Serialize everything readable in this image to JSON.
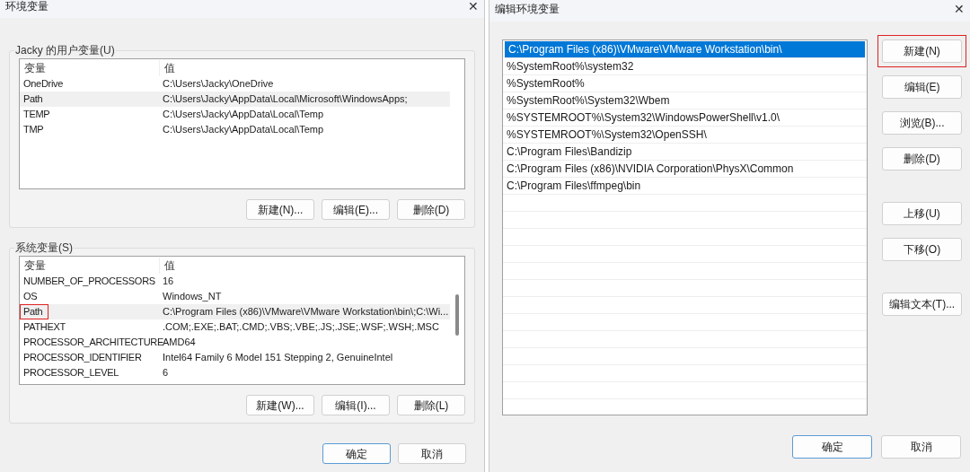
{
  "env_dialog": {
    "title": "环境变量",
    "close": "✕",
    "user_group": {
      "label": "Jacky 的用户变量(U)",
      "columns": [
        "变量",
        "值"
      ],
      "rows": [
        {
          "name": "OneDrive",
          "value": "C:\\Users\\Jacky\\OneDrive",
          "selected": false,
          "highlighted": false
        },
        {
          "name": "Path",
          "value": "C:\\Users\\Jacky\\AppData\\Local\\Microsoft\\WindowsApps;",
          "selected": true,
          "highlighted": false
        },
        {
          "name": "TEMP",
          "value": "C:\\Users\\Jacky\\AppData\\Local\\Temp",
          "selected": false,
          "highlighted": false
        },
        {
          "name": "TMP",
          "value": "C:\\Users\\Jacky\\AppData\\Local\\Temp",
          "selected": false,
          "highlighted": false
        }
      ],
      "buttons": [
        "新建(N)...",
        "编辑(E)...",
        "删除(D)"
      ]
    },
    "system_group": {
      "label": "系统变量(S)",
      "columns": [
        "变量",
        "值"
      ],
      "rows": [
        {
          "name": "NUMBER_OF_PROCESSORS",
          "value": "16",
          "selected": false,
          "highlighted": false
        },
        {
          "name": "OS",
          "value": "Windows_NT",
          "selected": false,
          "highlighted": false
        },
        {
          "name": "Path",
          "value": "C:\\Program Files (x86)\\VMware\\VMware Workstation\\bin\\;C:\\Wi...",
          "selected": true,
          "highlighted": true
        },
        {
          "name": "PATHEXT",
          "value": ".COM;.EXE;.BAT;.CMD;.VBS;.VBE;.JS;.JSE;.WSF;.WSH;.MSC",
          "selected": false,
          "highlighted": false
        },
        {
          "name": "PROCESSOR_ARCHITECTURE",
          "value": "AMD64",
          "selected": false,
          "highlighted": false
        },
        {
          "name": "PROCESSOR_IDENTIFIER",
          "value": "Intel64 Family 6 Model 151 Stepping 2, GenuineIntel",
          "selected": false,
          "highlighted": false
        },
        {
          "name": "PROCESSOR_LEVEL",
          "value": "6",
          "selected": false,
          "highlighted": false
        }
      ],
      "buttons": [
        "新建(W)...",
        "编辑(I)...",
        "删除(L)"
      ]
    },
    "ok": "确定",
    "cancel": "取消"
  },
  "edit_dialog": {
    "title": "编辑环境变量",
    "close": "✕",
    "entries": [
      {
        "text": "C:\\Program Files (x86)\\VMware\\VMware Workstation\\bin\\",
        "selected": true
      },
      {
        "text": "%SystemRoot%\\system32",
        "selected": false
      },
      {
        "text": "%SystemRoot%",
        "selected": false
      },
      {
        "text": "%SystemRoot%\\System32\\Wbem",
        "selected": false
      },
      {
        "text": "%SYSTEMROOT%\\System32\\WindowsPowerShell\\v1.0\\",
        "selected": false
      },
      {
        "text": "%SYSTEMROOT%\\System32\\OpenSSH\\",
        "selected": false
      },
      {
        "text": "C:\\Program Files\\Bandizip",
        "selected": false
      },
      {
        "text": "C:\\Program Files (x86)\\NVIDIA Corporation\\PhysX\\Common",
        "selected": false
      },
      {
        "text": "C:\\Program Files\\ffmpeg\\bin",
        "selected": false
      }
    ],
    "button_groups": [
      [
        {
          "label": "新建(N)",
          "highlighted": true
        },
        {
          "label": "编辑(E)",
          "highlighted": false
        },
        {
          "label": "浏览(B)...",
          "highlighted": false
        },
        {
          "label": "删除(D)",
          "highlighted": false
        }
      ],
      [
        {
          "label": "上移(U)",
          "highlighted": false
        },
        {
          "label": "下移(O)",
          "highlighted": false
        }
      ],
      [
        {
          "label": "编辑文本(T)...",
          "highlighted": false
        }
      ]
    ],
    "ok": "确定",
    "cancel": "取消"
  }
}
